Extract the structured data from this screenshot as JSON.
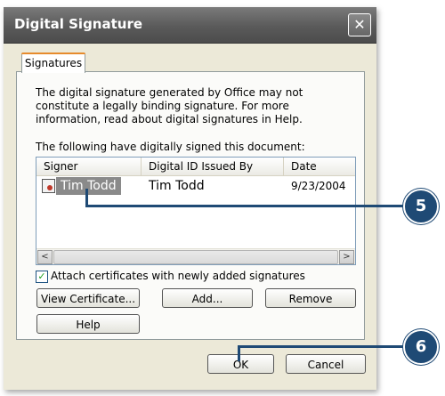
{
  "dialog": {
    "title": "Digital Signature",
    "close_glyph": "✕",
    "tab_label": "Signatures",
    "info_text": "The digital signature generated by Office may not constitute a legally binding signature. For more information, read about digital signatures in Help.",
    "list_caption": "The following have digitally signed this document:"
  },
  "listview": {
    "columns": [
      "Signer",
      "Digital ID Issued By",
      "Date"
    ],
    "rows": [
      {
        "signer": "Tim Todd",
        "issuer": "Tim Todd",
        "date": "9/23/2004",
        "icon": "certificate-icon"
      }
    ],
    "scroll_left_glyph": "<",
    "scroll_right_glyph": ">"
  },
  "checkbox": {
    "label": "Attach certificates with newly added signatures",
    "checked": true,
    "check_glyph": "✓"
  },
  "buttons": {
    "view_certificate": "View Certificate...",
    "add": "Add...",
    "remove": "Remove",
    "help": "Help",
    "ok": "OK",
    "cancel": "Cancel"
  },
  "callouts": [
    "5",
    "6"
  ],
  "colors": {
    "accent": "#1f4a75",
    "selection": "#8a8a8a",
    "tab_highlight": "#e68b2c",
    "dialog_bg": "#ece9d8"
  }
}
